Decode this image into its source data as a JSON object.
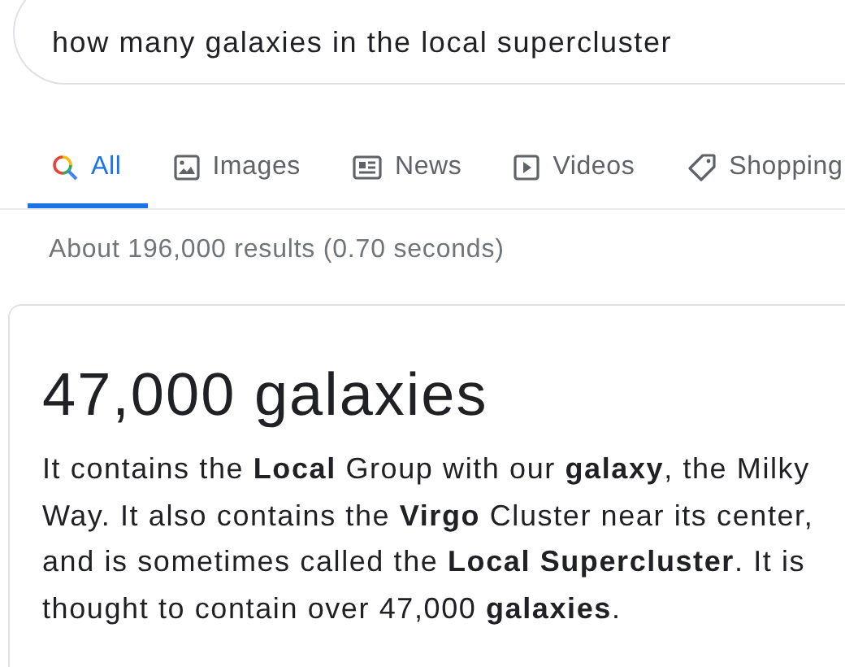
{
  "search": {
    "value": "how many galaxies in the local supercluster"
  },
  "tabs": [
    {
      "label": "All",
      "kind": "search",
      "selected": true
    },
    {
      "label": "Images",
      "kind": "image",
      "selected": false
    },
    {
      "label": "News",
      "kind": "news",
      "selected": false
    },
    {
      "label": "Videos",
      "kind": "video",
      "selected": false
    },
    {
      "label": "Shopping",
      "kind": "tag",
      "selected": false
    }
  ],
  "result_stats": "About 196,000 results (0.70 seconds)",
  "answer": {
    "heading": "47,000 galaxies",
    "text": "It contains the **Local** Group with our **galaxy**, the Milky Way. It also contains the **Virgo** Cluster near its center, and is sometimes called the **Local Supercluster**. It is thought to contain over 47,000 **galaxies**."
  }
}
